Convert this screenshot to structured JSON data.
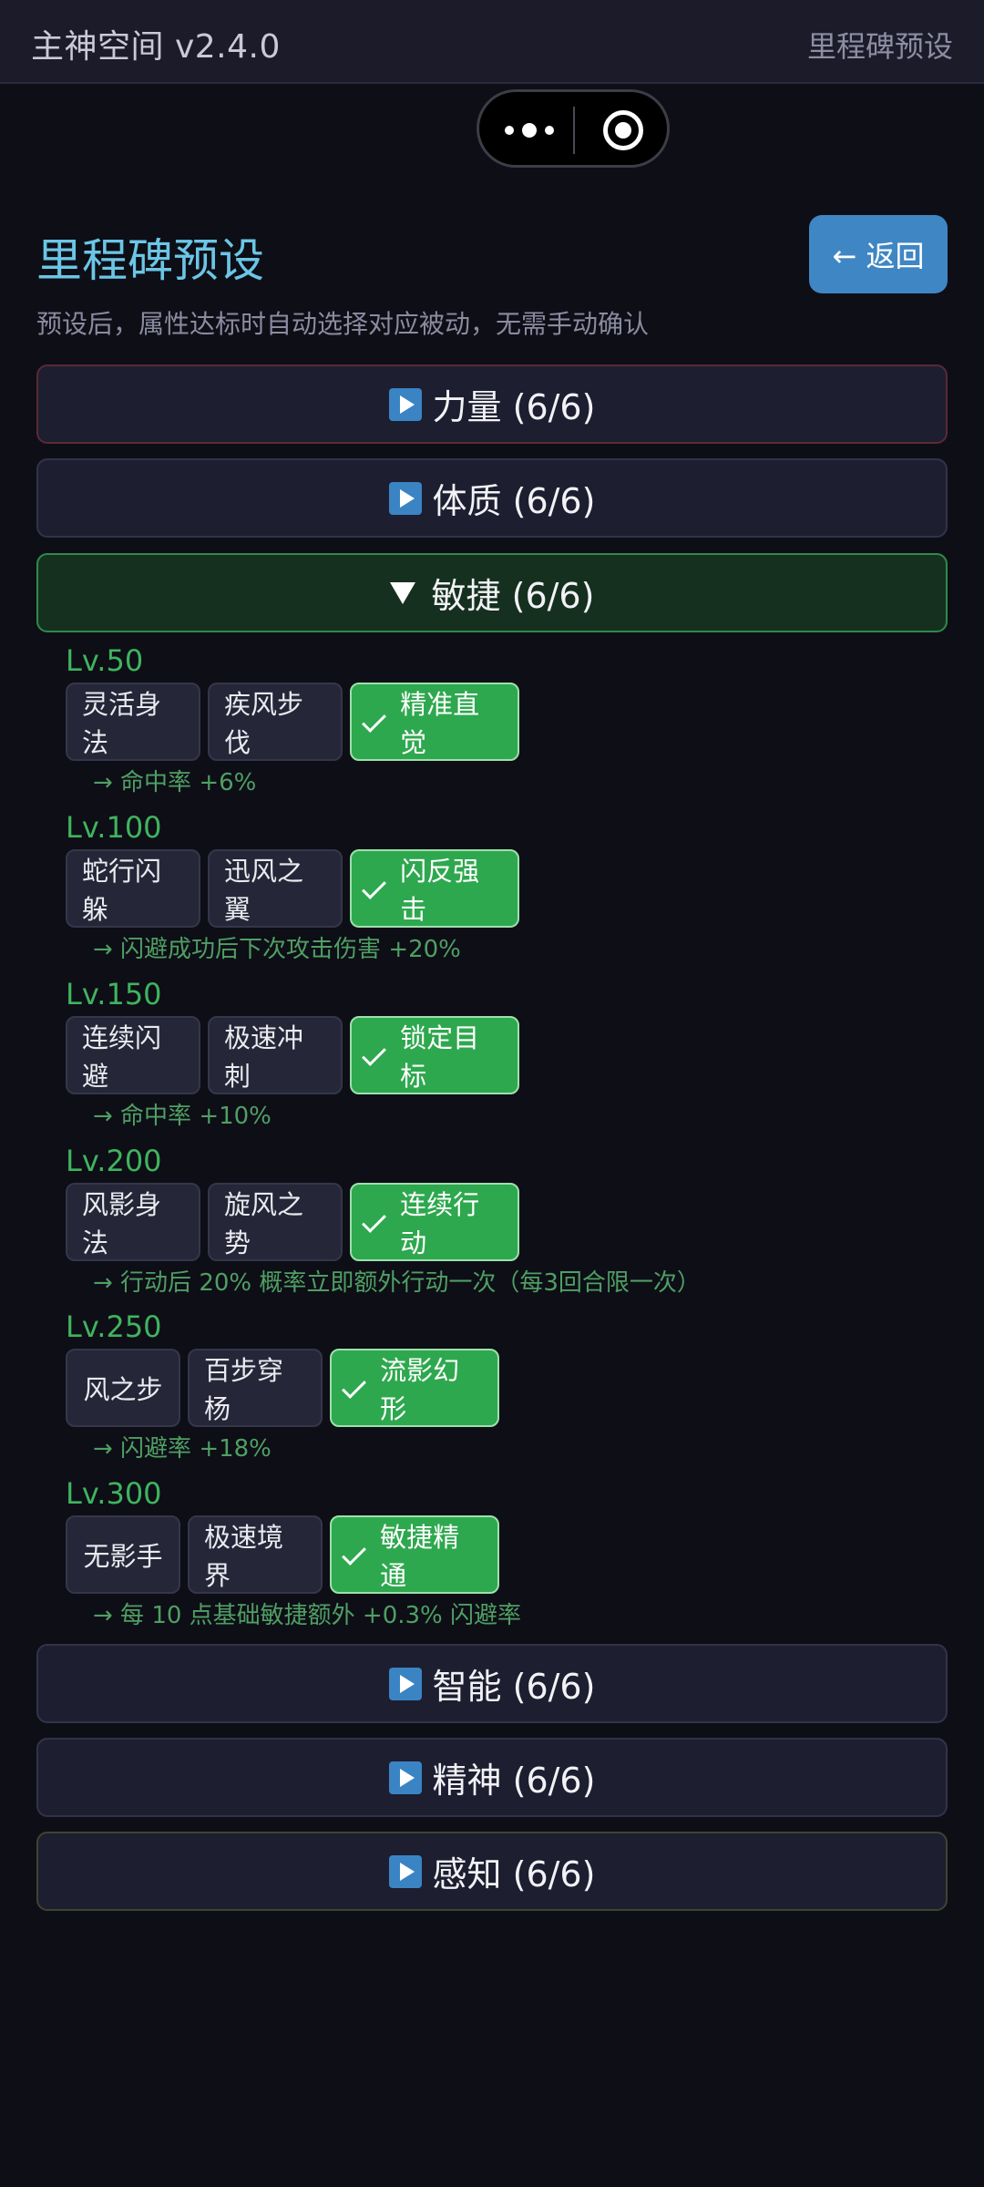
{
  "app": {
    "title": "主神空间 v2.4.0",
    "right_label": "里程碑预设"
  },
  "header": {
    "title": "里程碑预设",
    "back_label": "← 返回",
    "subtitle": "预设后，属性达标时自动选择对应被动，无需手动确认"
  },
  "categories": [
    {
      "label": "力量 (6/6)",
      "expanded": false
    },
    {
      "label": "体质 (6/6)",
      "expanded": false
    },
    {
      "label": "敏捷 (6/6)",
      "expanded": true
    },
    {
      "label": "智能 (6/6)",
      "expanded": false
    },
    {
      "label": "精神 (6/6)",
      "expanded": false
    },
    {
      "label": "感知 (6/6)",
      "expanded": false
    }
  ],
  "agility_levels": [
    {
      "level": "Lv.50",
      "options": [
        "灵活身法",
        "疾风步伐",
        "精准直觉"
      ],
      "selected": 2,
      "desc": "→ 命中率 +6%"
    },
    {
      "level": "Lv.100",
      "options": [
        "蛇行闪躲",
        "迅风之翼",
        "闪反强击"
      ],
      "selected": 2,
      "desc": "→ 闪避成功后下次攻击伤害 +20%"
    },
    {
      "level": "Lv.150",
      "options": [
        "连续闪避",
        "极速冲刺",
        "锁定目标"
      ],
      "selected": 2,
      "desc": "→ 命中率 +10%"
    },
    {
      "level": "Lv.200",
      "options": [
        "风影身法",
        "旋风之势",
        "连续行动"
      ],
      "selected": 2,
      "desc": "→ 行动后 20% 概率立即额外行动一次（每3回合限一次）"
    },
    {
      "level": "Lv.250",
      "options": [
        "风之步",
        "百步穿杨",
        "流影幻形"
      ],
      "selected": 2,
      "desc": "→ 闪避率 +18%"
    },
    {
      "level": "Lv.300",
      "options": [
        "无影手",
        "极速境界",
        "敏捷精通"
      ],
      "selected": 2,
      "desc": "→ 每 10 点基础敏捷额外 +0.3% 闪避率"
    }
  ]
}
